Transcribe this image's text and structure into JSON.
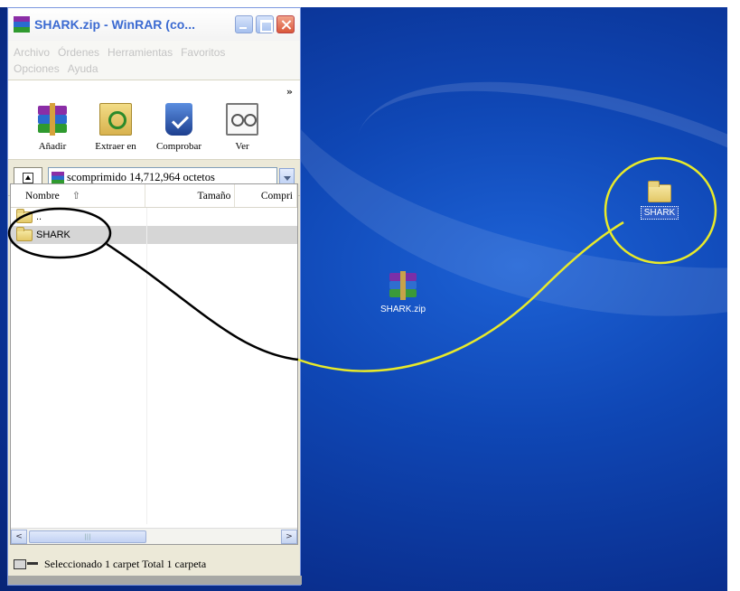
{
  "window": {
    "title": "SHARK.zip - WinRAR (co...",
    "menu": [
      "Archivo",
      "Órdenes",
      "Herramientas",
      "Favoritos",
      "Opciones",
      "Ayuda"
    ]
  },
  "toolbar": {
    "add_label": "Añadir",
    "extract_label": "Extraer en",
    "test_label": "Comprobar",
    "view_label": "Ver",
    "more_label": "»"
  },
  "address": {
    "path": "scomprimido 14,712,964 octetos"
  },
  "filelist": {
    "columns": [
      "Nombre",
      "Tamaño",
      "Compri"
    ],
    "sort_indicator": "⇧",
    "rows": [
      {
        "name": ".."
      },
      {
        "name": "SHARK"
      }
    ]
  },
  "scrollbar": {
    "left_arrow": "<",
    "right_arrow": ">",
    "thumb_grip": "|||"
  },
  "status": {
    "text": "Seleccionado 1 carpet Total 1 carpeta"
  },
  "desktop": {
    "icons": [
      {
        "label": "SHARK",
        "icon": "folder-icon"
      },
      {
        "label": "SHARK.zip",
        "icon": "winrar-archive-icon"
      }
    ]
  },
  "colors": {
    "desktop_blue": "#0f47b5",
    "annotation_yellow": "#e8ea2a",
    "annotation_black": "#000000",
    "title_text": "#3b6ad1"
  }
}
